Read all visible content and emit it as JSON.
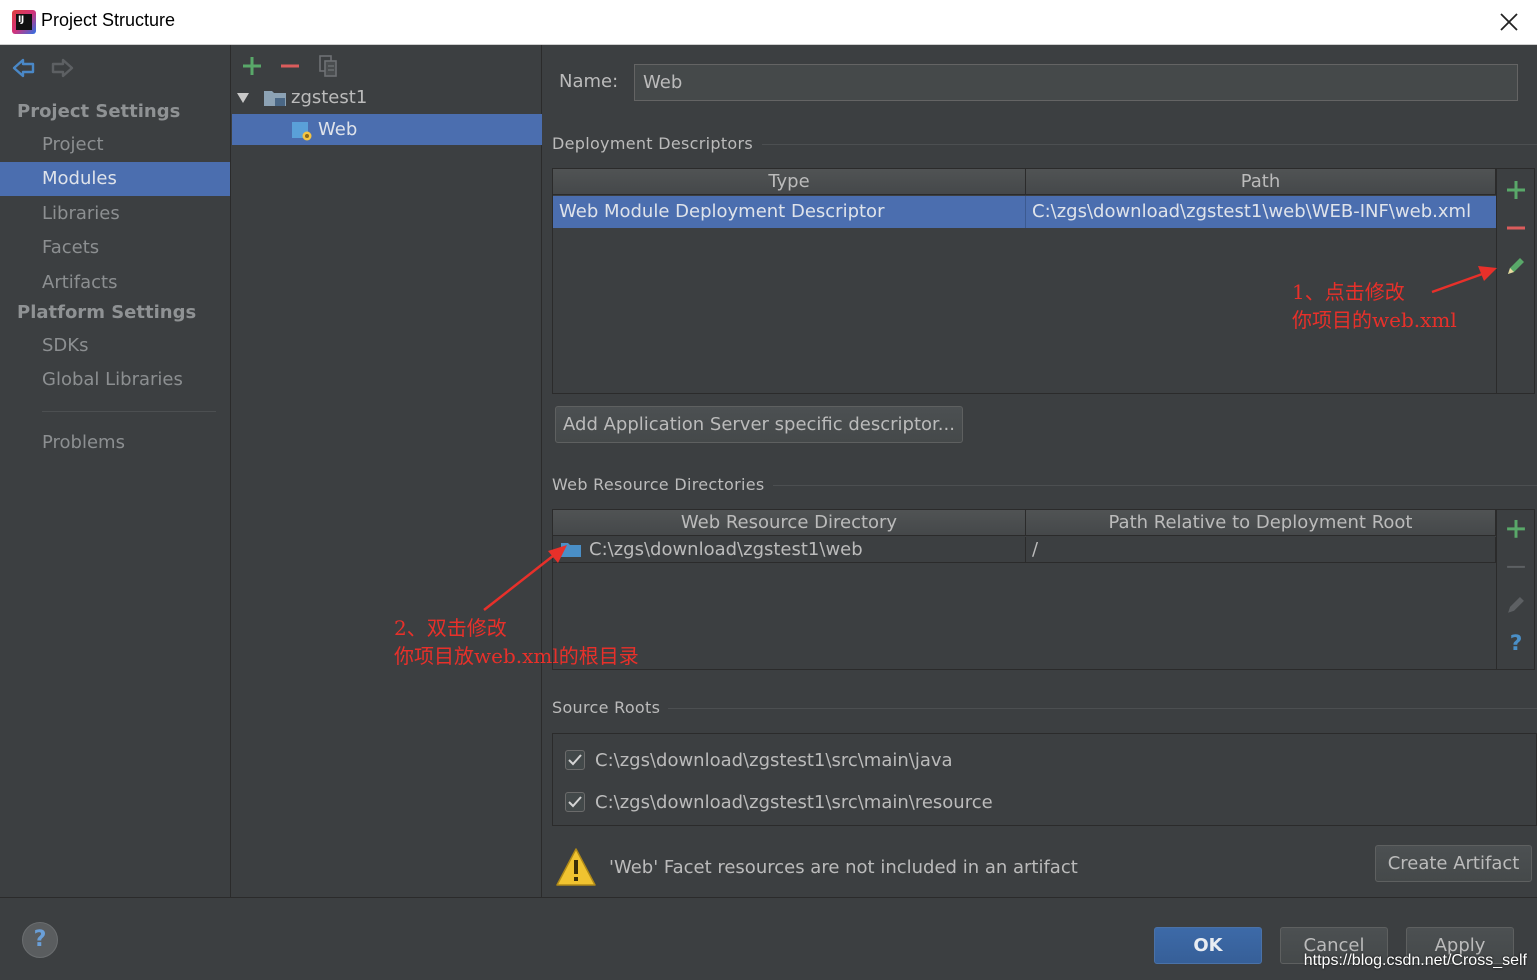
{
  "window": {
    "title": "Project Structure"
  },
  "sidebar": {
    "project_settings_header": "Project Settings",
    "platform_settings_header": "Platform Settings",
    "items": [
      {
        "label": "Project"
      },
      {
        "label": "Modules"
      },
      {
        "label": "Libraries"
      },
      {
        "label": "Facets"
      },
      {
        "label": "Artifacts"
      },
      {
        "label": "SDKs"
      },
      {
        "label": "Global Libraries"
      },
      {
        "label": "Problems"
      }
    ]
  },
  "tree": {
    "root": "zgstest1",
    "child": "Web"
  },
  "form": {
    "name_label": "Name:",
    "name_value": "Web"
  },
  "deployment": {
    "title": "Deployment Descriptors",
    "columns": [
      "Type",
      "Path"
    ],
    "rows": [
      {
        "type": "Web Module Deployment Descriptor",
        "path": "C:\\zgs\\download\\zgstest1\\web\\WEB-INF\\web.xml"
      }
    ],
    "add_server_button": "Add Application Server specific descriptor..."
  },
  "web_resources": {
    "title": "Web Resource Directories",
    "columns": [
      "Web Resource Directory",
      "Path Relative to Deployment Root"
    ],
    "rows": [
      {
        "dir": "C:\\zgs\\download\\zgstest1\\web",
        "relative": "/"
      }
    ]
  },
  "source_roots": {
    "title": "Source Roots",
    "items": [
      {
        "path": "C:\\zgs\\download\\zgstest1\\src\\main\\java",
        "checked": true
      },
      {
        "path": "C:\\zgs\\download\\zgstest1\\src\\main\\resource",
        "checked": true
      }
    ]
  },
  "warning": {
    "text": "'Web' Facet resources are not included in an artifact",
    "button": "Create Artifact"
  },
  "footer": {
    "ok": "OK",
    "cancel": "Cancel",
    "apply": "Apply",
    "help": "?"
  },
  "annotations": {
    "one_line1": "1、点击修改",
    "one_line2": "你项目的web.xml",
    "two_line1": "2、双击修改",
    "two_line2": "你项目放web.xml的根目录"
  },
  "watermark": "https://blog.csdn.net/Cross_self",
  "colors": {
    "background": "#3c3f41",
    "selection": "#4b6eaf",
    "add_green": "#59a869",
    "remove_red": "#db5c5c",
    "annotation_red": "#e8302a"
  }
}
